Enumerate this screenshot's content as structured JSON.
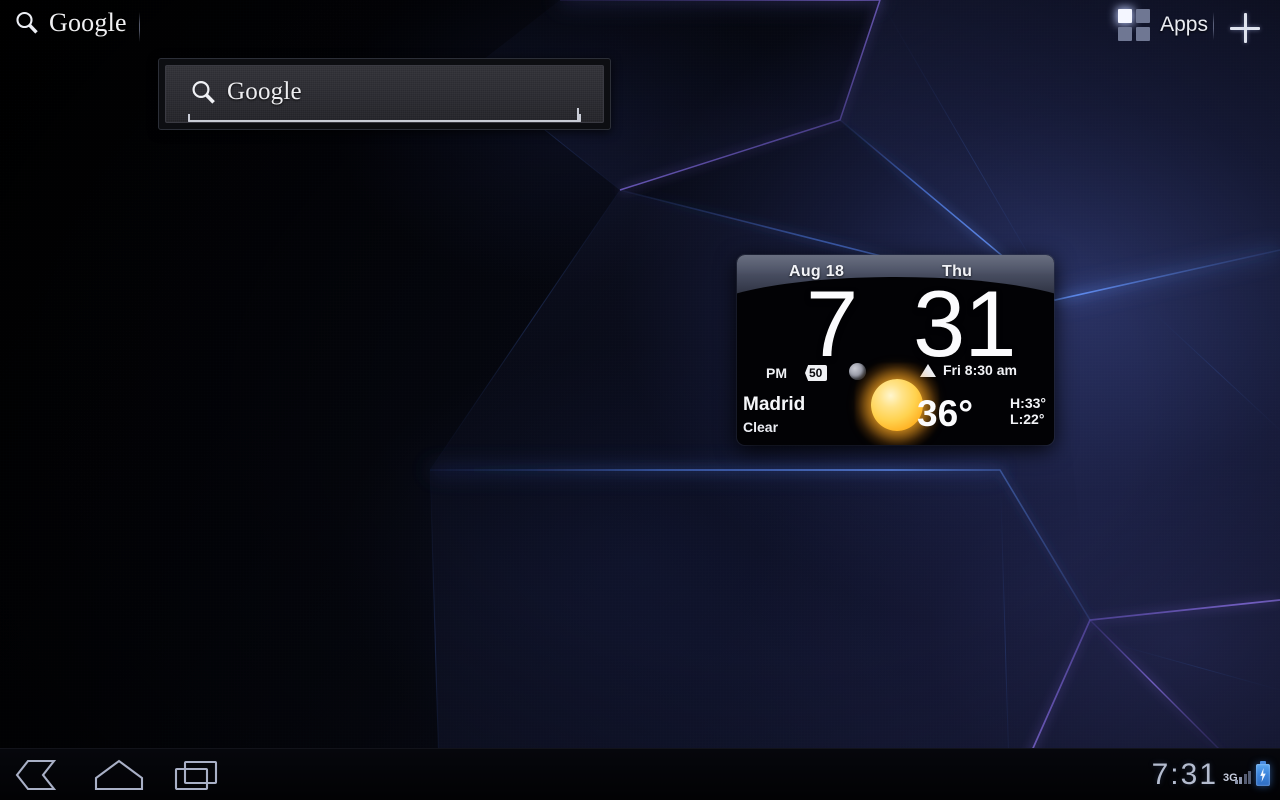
{
  "topbar": {
    "google_label": "Google",
    "search_icon": "search-icon",
    "apps_label": "Apps",
    "apps_icon": "apps-grid-icon",
    "add_icon": "plus-icon"
  },
  "search_widget": {
    "placeholder": "Google",
    "value": "",
    "icon": "search-icon"
  },
  "clock_widget": {
    "date": "Aug  18",
    "day": "Thu",
    "hour": "7",
    "minute": "31",
    "ampm": "PM",
    "seconds_badge": "50",
    "moon_icon": "moon-icon",
    "alarm_icon": "alarm-bell-icon",
    "alarm_text": "Fri 8:30 am",
    "city": "Madrid",
    "condition": "Clear",
    "weather_icon": "sun-icon",
    "temperature": "36°",
    "high": "H:33°",
    "low": "L:22°",
    "accent_sun": "#ffd24f",
    "header_color": "#4b5165"
  },
  "system_bar": {
    "back_icon": "back-arrow-icon",
    "home_icon": "home-icon",
    "recent_icon": "recent-apps-icon",
    "clock": "7:31",
    "network": "3G",
    "signal_icon": "signal-bars-icon",
    "battery_icon": "battery-charging-icon"
  },
  "wallpaper": {
    "name": "hexagon-nebula-wallpaper",
    "base_color": "#04050a",
    "glow_blue": "#4a6fd8",
    "glow_purple": "#7a5fd0"
  }
}
